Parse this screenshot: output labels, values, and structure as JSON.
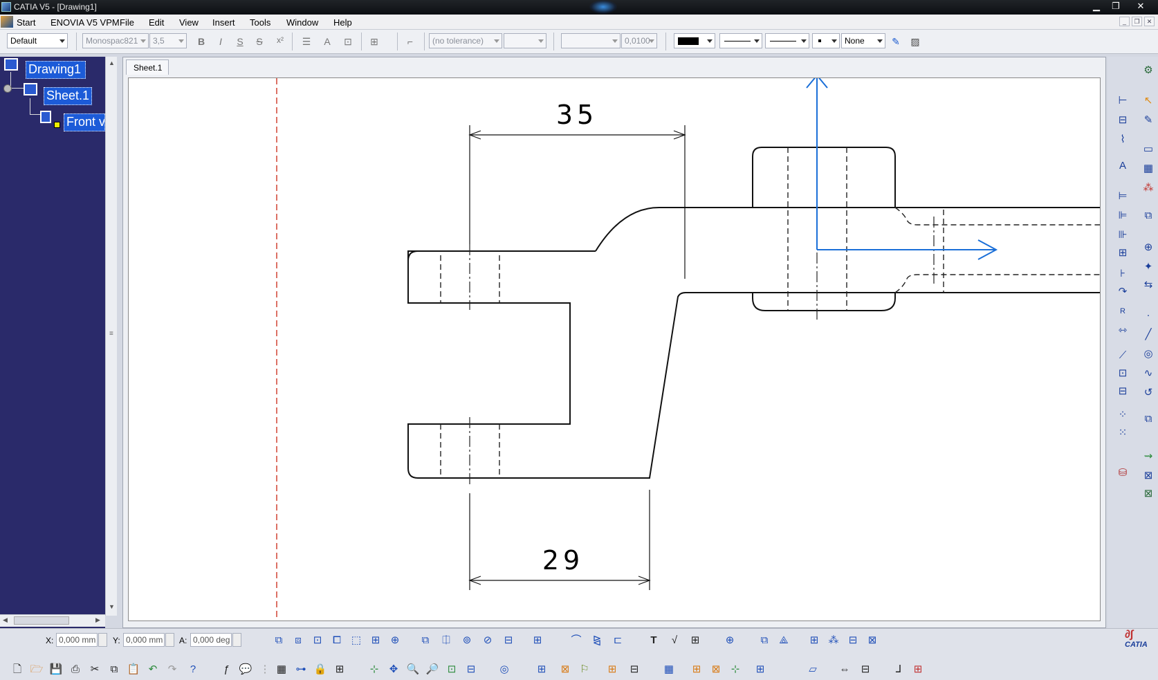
{
  "window": {
    "title": "CATIA V5 - [Drawing1]"
  },
  "menu": {
    "items": [
      "Start",
      "ENOVIA V5 VPM",
      "File",
      "Edit",
      "View",
      "Insert",
      "Tools",
      "Window",
      "Help"
    ]
  },
  "text_toolbar": {
    "style": "Default",
    "font": "Monospac821",
    "font_size": "3,5",
    "bold": "B",
    "italic": "I",
    "underline": "S",
    "strike": "S",
    "superscript": "x²",
    "tolerance": "(no tolerance)",
    "precision": "0,0100",
    "line_type": "None"
  },
  "tree": {
    "root": "Drawing1",
    "sheet": "Sheet.1",
    "view": "Front view"
  },
  "sheet_tab": "Sheet.1",
  "drawing": {
    "dim_top": "35",
    "dim_bottom": "29"
  },
  "coords": {
    "x_label": "X:",
    "x_value": "0,000 mm",
    "y_label": "Y:",
    "y_value": "0,000 mm",
    "a_label": "A:",
    "a_value": "0,000 deg"
  },
  "branding": {
    "logo": "CATIA"
  },
  "colors": {
    "tree_bg": "#2a2a6a",
    "selection": "#1c5bd8",
    "axis_blue": "#1a6fd8",
    "centerline_red": "#d04030"
  }
}
